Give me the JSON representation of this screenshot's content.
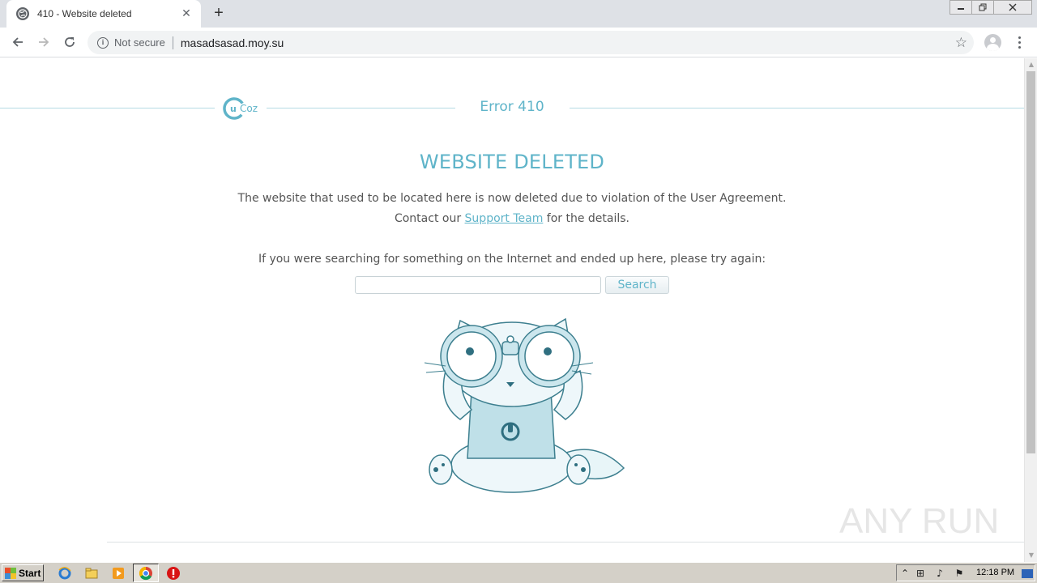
{
  "browser": {
    "tab_title": "410 - Website deleted",
    "tab_close": "✕",
    "new_tab": "+",
    "security_label": "Not secure",
    "url": "masadsasad.moy.su"
  },
  "page": {
    "logo_text": "uCoz",
    "error_code": "Error 410",
    "headline": "WEBSITE DELETED",
    "message_line1": "The website that used to be located here is now deleted due to violation of the User Agreement.",
    "message_line2_prefix": "Contact our ",
    "support_link": "Support Team",
    "message_line2_suffix": " for the details.",
    "search_prompt": "If you were searching for something on the Internet and ended up here, please try again:",
    "search_value": "",
    "search_button": "Search",
    "watermark": "ANY RUN"
  },
  "taskbar": {
    "start_label": "Start",
    "clock": "12:18 PM"
  },
  "colors": {
    "accent": "#5fb4c9",
    "tab_strip": "#dee1e6",
    "taskbar": "#d4d0c8"
  }
}
